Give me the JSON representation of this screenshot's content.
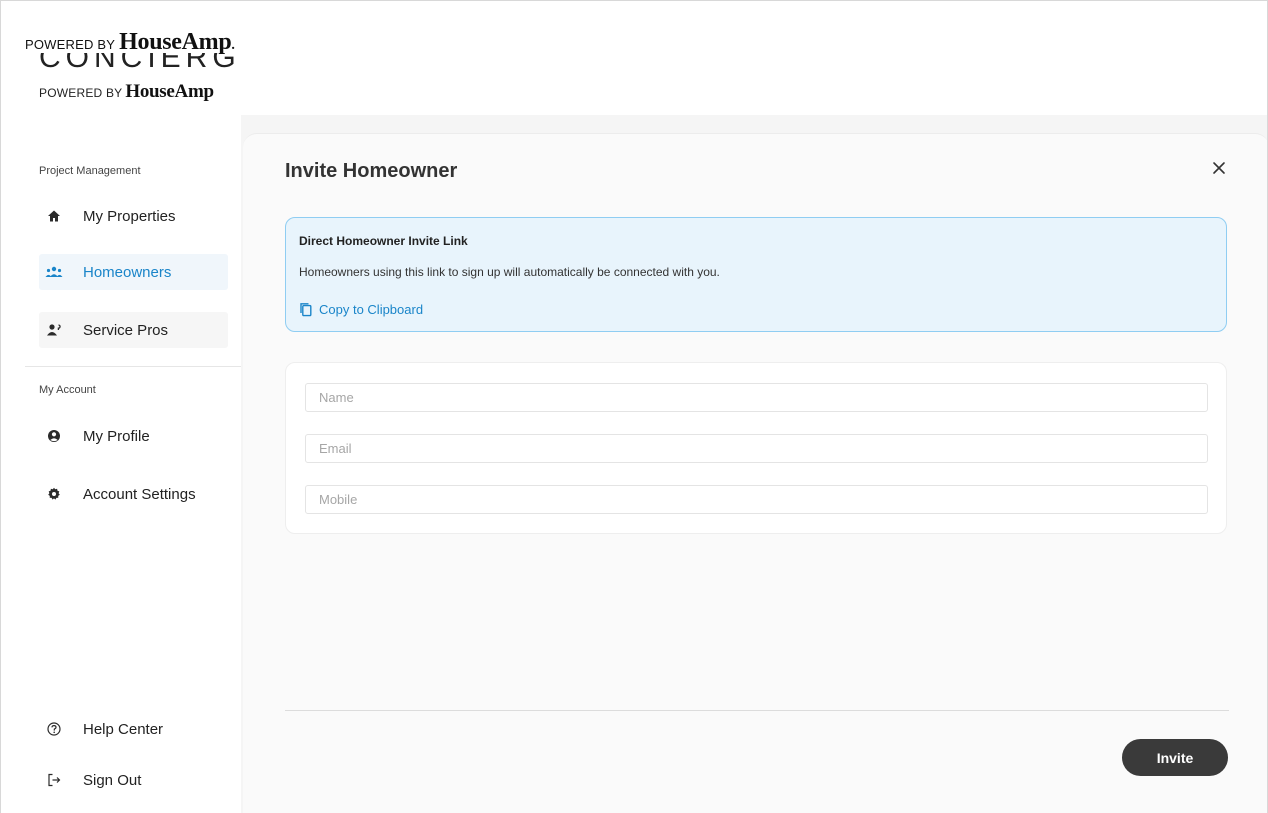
{
  "header": {
    "powered_by": "POWERED BY",
    "brand": "HouseAmp",
    "brand_suffix": "."
  },
  "logo": {
    "wordmark": "CONCIERGE",
    "powered_by": "POWERED BY",
    "brand": "HouseAmp"
  },
  "sidebar": {
    "sections": [
      {
        "title": "Project Management",
        "items": [
          {
            "label": "My Properties",
            "icon": "home-icon",
            "active": false
          },
          {
            "label": "Homeowners",
            "icon": "people-group-icon",
            "active": true
          },
          {
            "label": "Service Pros",
            "icon": "service-pro-icon",
            "active": false
          }
        ]
      },
      {
        "title": "My Account",
        "items": [
          {
            "label": "My Profile",
            "icon": "user-circle-icon",
            "active": false
          },
          {
            "label": "Account Settings",
            "icon": "gear-icon",
            "active": false
          }
        ]
      }
    ],
    "footer_items": [
      {
        "label": "Help Center",
        "icon": "help-icon"
      },
      {
        "label": "Sign Out",
        "icon": "sign-out-icon"
      }
    ]
  },
  "modal": {
    "title": "Invite Homeowner",
    "close_icon": "close-icon",
    "invite_link": {
      "heading": "Direct Homeowner Invite Link",
      "description": "Homeowners using this link to sign up will automatically be connected with you.",
      "copy_label": "Copy to Clipboard",
      "copy_icon": "copy-icon"
    },
    "form": {
      "name_placeholder": "Name",
      "name_value": "",
      "email_placeholder": "Email",
      "email_value": "",
      "mobile_placeholder": "Mobile",
      "mobile_value": ""
    },
    "invite_button": "Invite"
  },
  "colors": {
    "accent": "#1a85c9",
    "active_bg": "#f0f6fb",
    "invite_box_bg": "#e8f4fc",
    "invite_box_border": "#8fcdf2",
    "button_bg": "#3a3a3a"
  }
}
